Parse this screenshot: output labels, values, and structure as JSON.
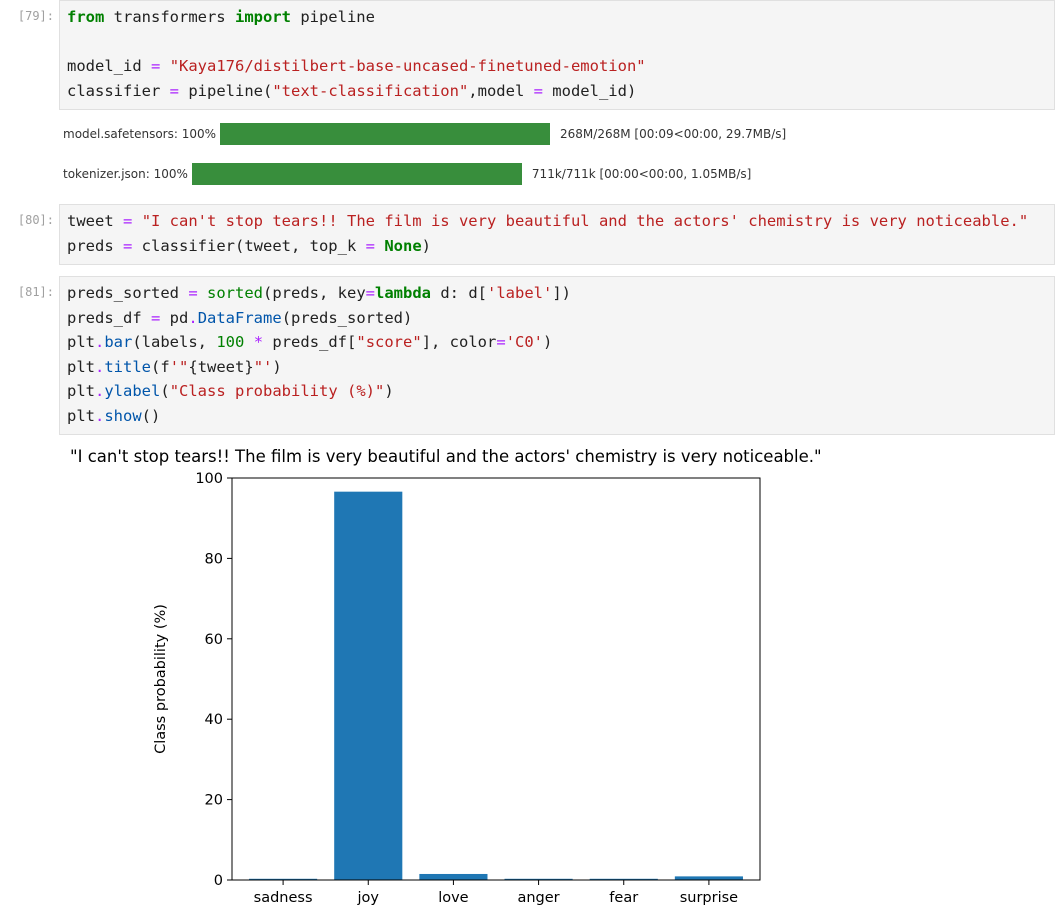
{
  "cells": [
    {
      "prompt": "[79]:",
      "lines": [
        [
          {
            "t": "from",
            "c": "kw"
          },
          {
            "t": " transformers "
          },
          {
            "t": "import",
            "c": "kw"
          },
          {
            "t": " pipeline"
          }
        ],
        [],
        [
          {
            "t": "model_id "
          },
          {
            "t": "=",
            "c": "op"
          },
          {
            "t": " "
          },
          {
            "t": "\"Kaya176/distilbert-base-uncased-finetuned-emotion\"",
            "c": "str"
          }
        ],
        [
          {
            "t": "classifier "
          },
          {
            "t": "=",
            "c": "op"
          },
          {
            "t": " pipeline("
          },
          {
            "t": "\"text-classification\"",
            "c": "str"
          },
          {
            "t": ",model "
          },
          {
            "t": "=",
            "c": "op"
          },
          {
            "t": " model_id)"
          }
        ]
      ]
    },
    {
      "prompt": "[80]:",
      "lines": [
        [
          {
            "t": "tweet "
          },
          {
            "t": "=",
            "c": "op"
          },
          {
            "t": " "
          },
          {
            "t": "\"I can't stop tears!! The film is very beautiful and the actors' chemistry is very noticeable.\"",
            "c": "str"
          }
        ],
        [
          {
            "t": "preds "
          },
          {
            "t": "=",
            "c": "op"
          },
          {
            "t": " classifier(tweet, top_k "
          },
          {
            "t": "=",
            "c": "op"
          },
          {
            "t": " "
          },
          {
            "t": "None",
            "c": "kw"
          },
          {
            "t": ")"
          }
        ]
      ]
    },
    {
      "prompt": "[81]:",
      "lines": [
        [
          {
            "t": "preds_sorted "
          },
          {
            "t": "=",
            "c": "op"
          },
          {
            "t": " "
          },
          {
            "t": "sorted",
            "c": "kw2"
          },
          {
            "t": "(preds, key"
          },
          {
            "t": "=",
            "c": "op"
          },
          {
            "t": "lambda",
            "c": "kw"
          },
          {
            "t": " d: d["
          },
          {
            "t": "'label'",
            "c": "str"
          },
          {
            "t": "])"
          }
        ],
        [
          {
            "t": "preds_df "
          },
          {
            "t": "=",
            "c": "op"
          },
          {
            "t": " pd"
          },
          {
            "t": ".",
            "c": "op"
          },
          {
            "t": "DataFrame",
            "c": "fn"
          },
          {
            "t": "(preds_sorted)"
          }
        ],
        [
          {
            "t": "plt"
          },
          {
            "t": ".",
            "c": "op"
          },
          {
            "t": "bar",
            "c": "fn"
          },
          {
            "t": "(labels, "
          },
          {
            "t": "100",
            "c": "num"
          },
          {
            "t": " "
          },
          {
            "t": "*",
            "c": "op"
          },
          {
            "t": " preds_df["
          },
          {
            "t": "\"score\"",
            "c": "str"
          },
          {
            "t": "], color"
          },
          {
            "t": "=",
            "c": "op"
          },
          {
            "t": "'C0'",
            "c": "str"
          },
          {
            "t": ")"
          }
        ],
        [
          {
            "t": "plt"
          },
          {
            "t": ".",
            "c": "op"
          },
          {
            "t": "title",
            "c": "fn"
          },
          {
            "t": "(f"
          },
          {
            "t": "'\"",
            "c": "str"
          },
          {
            "t": "{tweet}"
          },
          {
            "t": "\"'",
            "c": "str"
          },
          {
            "t": ")"
          }
        ],
        [
          {
            "t": "plt"
          },
          {
            "t": ".",
            "c": "op"
          },
          {
            "t": "ylabel",
            "c": "fn"
          },
          {
            "t": "("
          },
          {
            "t": "\"Class probability (%)\"",
            "c": "str"
          },
          {
            "t": ")"
          }
        ],
        [
          {
            "t": "plt"
          },
          {
            "t": ".",
            "c": "op"
          },
          {
            "t": "show",
            "c": "fn"
          },
          {
            "t": "()"
          }
        ]
      ]
    }
  ],
  "progress": [
    {
      "label": "model.safetensors: 100%",
      "fraction": 1.0,
      "stats": "268M/268M [00:09<00:00, 29.7MB/s]"
    },
    {
      "label": "tokenizer.json: 100%",
      "fraction": 1.0,
      "stats": "711k/711k [00:00<00:00, 1.05MB/s]"
    }
  ],
  "colors": {
    "progress_fill": "#388e3c",
    "bar_color": "#1f77b4"
  },
  "chart_data": {
    "type": "bar",
    "title": "\"I can't stop tears!! The film is very beautiful and the actors' chemistry is very noticeable.\"",
    "ylabel": "Class probability (%)",
    "xlabel": "",
    "categories": [
      "sadness",
      "joy",
      "love",
      "anger",
      "fear",
      "surprise"
    ],
    "values": [
      0.3,
      96.6,
      1.5,
      0.3,
      0.3,
      0.9
    ],
    "ylim": [
      0,
      100
    ],
    "yticks": [
      0,
      20,
      40,
      60,
      80,
      100
    ],
    "grid": false
  }
}
